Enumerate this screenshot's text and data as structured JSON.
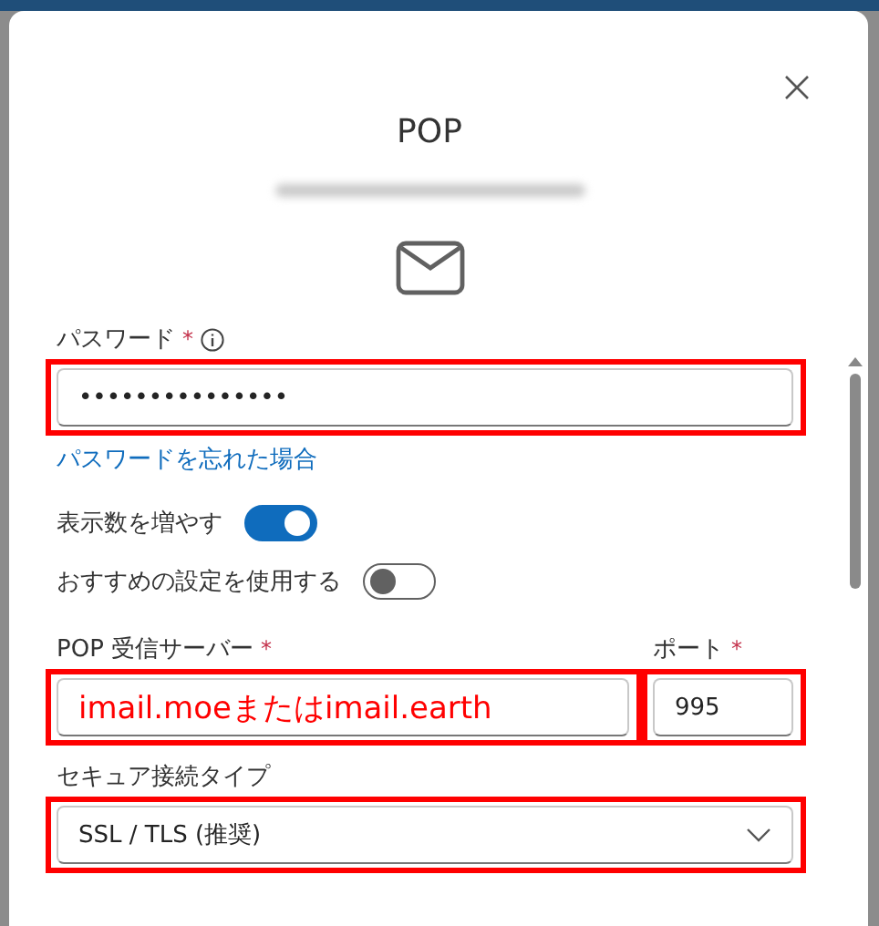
{
  "dialog": {
    "title": "POP"
  },
  "password": {
    "label": "パスワード",
    "required_mark": "*",
    "value": "•••••••••••••••",
    "highlighted": true
  },
  "forgot_link": "パスワードを忘れた場合",
  "toggles": [
    {
      "label": "表示数を増やす",
      "on": true
    },
    {
      "label": "おすすめの設定を使用する",
      "on": false
    }
  ],
  "server": {
    "label": "POP 受信サーバー",
    "required_mark": "*",
    "annotation": "imail.moeまたはimail.earth",
    "highlighted": true
  },
  "port": {
    "label": "ポート",
    "required_mark": "*",
    "value": "995",
    "highlighted": true
  },
  "security": {
    "label": "セキュア接続タイプ",
    "value": "SSL / TLS (推奨)",
    "highlighted": true
  }
}
